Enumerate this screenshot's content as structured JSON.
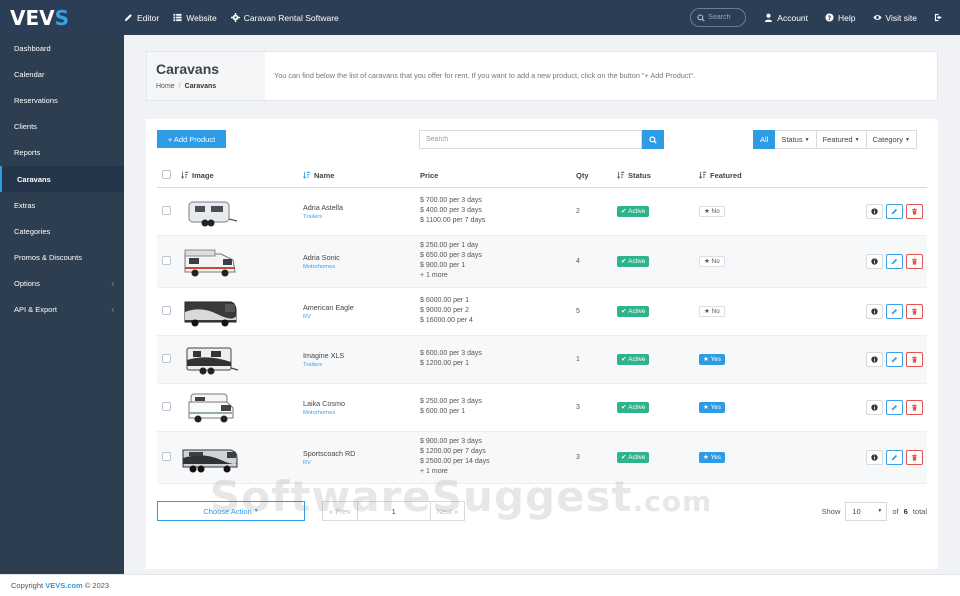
{
  "topbar": {
    "logo_main": "VEV",
    "logo_accent": "S",
    "nav": [
      {
        "label": "Editor",
        "icon": "pencil-icon"
      },
      {
        "label": "Website",
        "icon": "list-icon"
      },
      {
        "label": "Caravan Rental Software",
        "icon": "gear-icon"
      }
    ],
    "search_placeholder": "Search",
    "right": [
      {
        "label": "Account",
        "icon": "user-icon"
      },
      {
        "label": "Help",
        "icon": "question-icon"
      },
      {
        "label": "Visit site",
        "icon": "eye-icon"
      }
    ],
    "logout_icon": "logout-icon"
  },
  "sidebar": {
    "items": [
      {
        "label": "Dashboard",
        "chevron": false
      },
      {
        "label": "Calendar",
        "chevron": false
      },
      {
        "label": "Reservations",
        "chevron": false
      },
      {
        "label": "Clients",
        "chevron": false
      },
      {
        "label": "Reports",
        "chevron": false
      },
      {
        "label": "Caravans",
        "chevron": false,
        "active": true
      },
      {
        "label": "Extras",
        "chevron": false
      },
      {
        "label": "Categories",
        "chevron": false
      },
      {
        "label": "Promos & Discounts",
        "chevron": false
      },
      {
        "label": "Options",
        "chevron": true
      },
      {
        "label": "API & Export",
        "chevron": true
      }
    ],
    "chevron_glyph": "‹"
  },
  "header": {
    "title": "Caravans",
    "breadcrumb_home": "Home",
    "breadcrumb_sep": "/",
    "breadcrumb_current": "Caravans",
    "description": "You can find below the list of caravans that you offer for rent. If you want to add a new product, click on the button \"+ Add Product\"."
  },
  "toolbar": {
    "add_label": "+ Add Product",
    "search_placeholder": "Search",
    "filters": [
      "All",
      "Status",
      "Featured",
      "Category"
    ]
  },
  "table": {
    "columns": [
      "Image",
      "Name",
      "Price",
      "Qty",
      "Status",
      "Featured"
    ],
    "rows": [
      {
        "name": "Adria Astella",
        "category": "Trailers",
        "prices": [
          "$ 700.00 per 3 days",
          "$ 400.00 per 3 days",
          "$ 1100.00 per 7 days"
        ],
        "qty": "2",
        "status": "Active",
        "featured": "No",
        "thumb": "trailer"
      },
      {
        "name": "Adria Sonic",
        "category": "Motorhomes",
        "prices": [
          "$ 250.00 per 1 day",
          "$ 650.00 per 3 days",
          "$ 900.00 per 1",
          "+ 1 more"
        ],
        "qty": "4",
        "status": "Active",
        "featured": "No",
        "thumb": "motorhome"
      },
      {
        "name": "American Eagle",
        "category": "RV",
        "prices": [
          "$ 6000.00 per 1",
          "$ 9000.00 per 2",
          "$ 16000.00 per 4"
        ],
        "qty": "5",
        "status": "Active",
        "featured": "No",
        "thumb": "rv"
      },
      {
        "name": "Imagine XLS",
        "category": "Trailers",
        "prices": [
          "$ 600.00 per 3 days",
          "$ 1200.00 per 1"
        ],
        "qty": "1",
        "status": "Active",
        "featured": "Yes",
        "thumb": "trailer2"
      },
      {
        "name": "Laika Cosmo",
        "category": "Motorhomes",
        "prices": [
          "$ 250.00 per 3 days",
          "$ 600.00 per 1"
        ],
        "qty": "3",
        "status": "Active",
        "featured": "Yes",
        "thumb": "camper"
      },
      {
        "name": "Sportscoach RD",
        "category": "RV",
        "prices": [
          "$ 900.00 per 3 days",
          "$ 1200.00 per 7 days",
          "$ 2500.00 per 14 days",
          "+ 1 more"
        ],
        "qty": "3",
        "status": "Active",
        "featured": "Yes",
        "thumb": "coach"
      }
    ]
  },
  "bottom": {
    "choose_action": "Choose Action",
    "prev": "« Prev",
    "page": "1",
    "next": "Next »",
    "show_label": "Show",
    "show_value": "10",
    "of_label": "of",
    "total": "6",
    "total_label": "total"
  },
  "footer": {
    "prefix": "Copyright",
    "link": "VEVS.com",
    "suffix": "© 2023"
  },
  "watermark": {
    "main": "SoftwareSuggest",
    "suffix": ".com"
  },
  "colors": {
    "accent": "#2e9be5",
    "topbar": "#2c3e55",
    "sidebar": "#2d3e50",
    "active_green": "#2db48a",
    "delete_red": "#e05353"
  }
}
